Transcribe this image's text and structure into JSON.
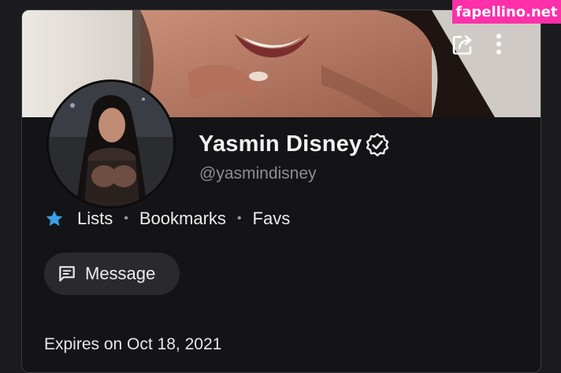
{
  "watermark": {
    "text": "fapellino.net",
    "color": "#ff2ea9"
  },
  "profile": {
    "name": "Yasmin Disney",
    "handle": "@yasmindisney",
    "verified": true,
    "verified_icon": "verified-badge-icon"
  },
  "cover_actions": {
    "share_icon": "share-icon",
    "more_icon": "more-vertical-icon"
  },
  "links": {
    "star_icon": "star-icon",
    "star_color": "#3aa0e8",
    "items": [
      "Lists",
      "Bookmarks",
      "Favs"
    ],
    "separator": "•"
  },
  "message_button": {
    "label": "Message",
    "icon": "message-icon"
  },
  "subscription": {
    "expires": "Expires on Oct 18, 2021"
  },
  "colors": {
    "background": "#1b1b1d",
    "card": "#141416",
    "button": "#2a2a2d",
    "muted_text": "#8d8d92"
  }
}
